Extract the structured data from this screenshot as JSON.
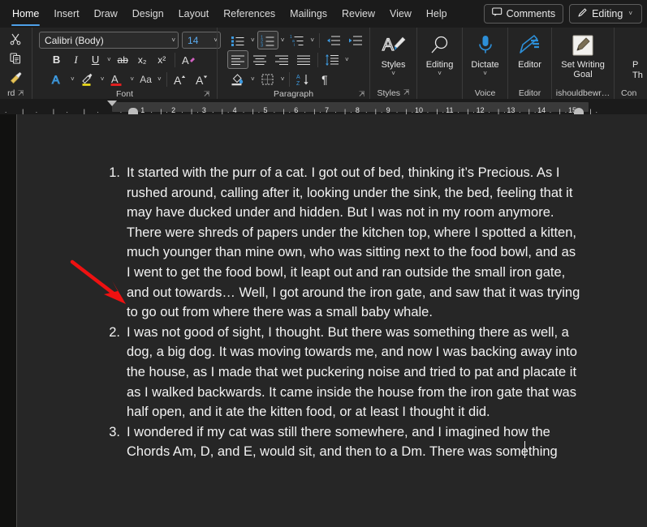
{
  "app": {
    "theme_background": "#1b1b1b",
    "accent": "#4ea0e8",
    "annotation_color": "#ee1111"
  },
  "tabs": [
    {
      "label": "Home",
      "active": true
    },
    {
      "label": "Insert",
      "active": false
    },
    {
      "label": "Draw",
      "active": false
    },
    {
      "label": "Design",
      "active": false
    },
    {
      "label": "Layout",
      "active": false
    },
    {
      "label": "References",
      "active": false
    },
    {
      "label": "Mailings",
      "active": false
    },
    {
      "label": "Review",
      "active": false
    },
    {
      "label": "View",
      "active": false
    },
    {
      "label": "Help",
      "active": false
    }
  ],
  "tabbar_right": {
    "comments_label": "Comments",
    "comments_icon": "comment-bubble-icon",
    "editing_label": "Editing",
    "editing_icon": "pencil-icon",
    "editing_caret": "˅"
  },
  "ribbon": {
    "groups": [
      {
        "name": "clipboard",
        "label": "rd",
        "has_dialog_launcher": true,
        "buttons": [
          {
            "name": "cut-button",
            "icon": "scissors-icon",
            "glyph": "✂"
          },
          {
            "name": "copy-button",
            "icon": "copy-icon",
            "glyph": "⎘"
          },
          {
            "name": "format-painter-button",
            "icon": "paintbrush-icon",
            "glyph": "🖌"
          }
        ]
      },
      {
        "name": "font",
        "label": "Font",
        "has_dialog_launcher": true,
        "font_name_value": "Calibri (Body)",
        "font_size_value": "14",
        "row2": [
          {
            "name": "bold-button",
            "label": "B"
          },
          {
            "name": "italic-button",
            "label": "I"
          },
          {
            "name": "underline-button",
            "label": "U"
          },
          {
            "name": "strikethrough-button",
            "label": "ab"
          },
          {
            "name": "subscript-button",
            "label": "x₂"
          },
          {
            "name": "superscript-button",
            "label": "x²"
          },
          {
            "name": "clear-formatting-button",
            "label": "A"
          }
        ],
        "row3": [
          {
            "name": "text-effects-button",
            "label": "A"
          },
          {
            "name": "text-highlight-color-button",
            "label": "A",
            "color": "#f4e11a"
          },
          {
            "name": "font-color-button",
            "label": "A",
            "color": "#e02020"
          },
          {
            "name": "change-case-button",
            "label": "Aa"
          },
          {
            "name": "grow-font-button",
            "label": "A"
          },
          {
            "name": "shrink-font-button",
            "label": "A"
          }
        ]
      },
      {
        "name": "paragraph",
        "label": "Paragraph",
        "has_dialog_launcher": true,
        "row1": [
          {
            "name": "bullets-button",
            "icon": "bullet-list-icon",
            "active": false
          },
          {
            "name": "numbering-button",
            "icon": "numbered-list-icon",
            "active": true
          },
          {
            "name": "multilevel-list-button",
            "icon": "multilevel-list-icon",
            "active": false
          },
          {
            "name": "decrease-indent-button",
            "icon": "decrease-indent-icon",
            "active": false
          },
          {
            "name": "increase-indent-button",
            "icon": "increase-indent-icon",
            "active": false
          }
        ],
        "row2": [
          {
            "name": "align-left-button",
            "icon": "align-left-icon",
            "active": true
          },
          {
            "name": "align-center-button",
            "icon": "align-center-icon",
            "active": false
          },
          {
            "name": "align-right-button",
            "icon": "align-right-icon",
            "active": false
          },
          {
            "name": "justify-button",
            "icon": "justify-icon",
            "active": false
          },
          {
            "name": "line-spacing-button",
            "icon": "line-spacing-icon",
            "active": false
          }
        ],
        "row3": [
          {
            "name": "shading-button",
            "icon": "shading-bucket-icon"
          },
          {
            "name": "borders-button",
            "icon": "borders-icon"
          },
          {
            "name": "sort-button",
            "icon": "sort-az-icon"
          },
          {
            "name": "show-formatting-marks-button",
            "icon": "pilcrow-icon",
            "glyph": "¶"
          }
        ]
      },
      {
        "name": "styles",
        "label": "Styles",
        "has_dialog_launcher": true,
        "button": {
          "name": "styles-button",
          "label": "Styles",
          "icon": "styles-brush-icon",
          "caret": "˅"
        }
      },
      {
        "name": "editing",
        "label": "",
        "has_dialog_launcher": false,
        "button": {
          "name": "editing-button",
          "label": "Editing",
          "icon": "magnifier-icon",
          "caret": "˅"
        }
      },
      {
        "name": "voice",
        "label": "Voice",
        "has_dialog_launcher": false,
        "button": {
          "name": "dictate-button",
          "label": "Dictate",
          "icon": "microphone-icon",
          "caret": "˅"
        }
      },
      {
        "name": "editor",
        "label": "Editor",
        "has_dialog_launcher": false,
        "button": {
          "name": "editor-button",
          "label": "Editor",
          "icon": "editor-pen-icon",
          "caret": ""
        }
      },
      {
        "name": "writing-goal",
        "label": "ishouldbewr…",
        "has_dialog_launcher": false,
        "button": {
          "name": "set-writing-goal-button",
          "label": "Set Writing Goal",
          "icon": "pencil-square-icon",
          "caret": ""
        }
      },
      {
        "name": "truncated-group",
        "label": "Con",
        "has_dialog_launcher": false,
        "button": {
          "name": "truncated-command-button",
          "label_line1": "P",
          "label_line2": "Th",
          "icon": "cut-off-icon"
        }
      }
    ]
  },
  "ruler": {
    "numbers": [
      "1",
      "2",
      "3",
      "4",
      "5",
      "6",
      "7",
      "8",
      "9",
      "10",
      "11",
      "12",
      "13",
      "14",
      "15"
    ],
    "first_line_indent_marker": "first-line-indent-marker",
    "hanging_indent_marker": "hanging-indent-marker",
    "right_indent_marker": "right-indent-marker"
  },
  "document": {
    "list_items": [
      {
        "number": "1.",
        "text": "It started with the purr of a cat. I got out of bed, thinking it’s Precious. As I rushed around, calling after it, looking under the sink, the bed, feeling that it may have ducked under and hidden. But I was not in my room anymore. There were shreds of papers under the kitchen top, where I spotted a kitten, much younger than mine own, who was sitting next to the food bowl, and as I went to get the food bowl, it leapt out and ran outside the small iron gate, and out towards… Well, I got around the iron gate, and saw that it was trying to go out from where there was a small baby whale."
      },
      {
        "number": "2.",
        "text": "I was not good of sight, I thought. But there was something there as well, a dog, a big dog. It was moving towards me, and now I was backing away into the house, as I made that wet puckering noise and tried to pat and placate it as I walked backwards. It came inside the house from the iron gate that was half open, and it ate the kitten food, or at least I thought it did."
      },
      {
        "number": "3.",
        "text": "I wondered if my cat was still there somewhere, and I imagined how the Chords Am, D, and E, would sit, and then to a Dm. There was something"
      }
    ],
    "text_cursor": "text-insertion-caret",
    "annotation": "red-arrow-pointing-to-first-list-item"
  }
}
